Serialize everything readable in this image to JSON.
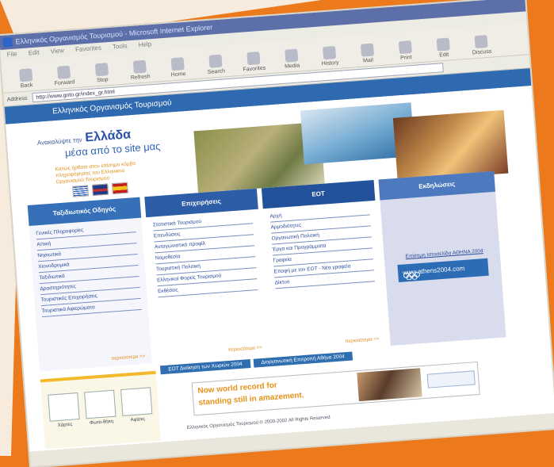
{
  "window": {
    "title": "Ελληνικός Οργανισμός Τουρισμού - Microsoft Internet Explorer"
  },
  "menu": [
    "File",
    "Edit",
    "View",
    "Favorites",
    "Tools",
    "Help"
  ],
  "toolbar": [
    {
      "label": "Back",
      "icon": "back-icon"
    },
    {
      "label": "Forward",
      "icon": "forward-icon"
    },
    {
      "label": "Stop",
      "icon": "stop-icon"
    },
    {
      "label": "Refresh",
      "icon": "refresh-icon"
    },
    {
      "label": "Home",
      "icon": "home-icon"
    },
    {
      "label": "Search",
      "icon": "search-icon"
    },
    {
      "label": "Favorites",
      "icon": "favorites-icon"
    },
    {
      "label": "Media",
      "icon": "media-icon"
    },
    {
      "label": "History",
      "icon": "history-icon"
    },
    {
      "label": "Mail",
      "icon": "mail-icon"
    },
    {
      "label": "Print",
      "icon": "print-icon"
    },
    {
      "label": "Edit",
      "icon": "edit-icon"
    },
    {
      "label": "Discuss",
      "icon": "discuss-icon"
    }
  ],
  "address": {
    "label": "Address",
    "value": "http://www.gnto.gr/index_gr.html"
  },
  "site": {
    "header": "Ελληνικός Οργανισμός Τουρισμού",
    "hero_line1": "Ανακαλύψτε την",
    "hero_line1_bold": "Ελλάδα",
    "hero_line2": "μέσα από το site μας",
    "hero_line3": "Καλώς ήρθατε στον επίσημο κόμβο πληροφόρησης του Ελληνικού Οργανισμού Τουρισμού"
  },
  "columns": [
    {
      "title": "Ταξιδιωτικός Οδηγός",
      "items": [
        "Γενικές Πληροφορίες",
        "Αττική",
        "Νησιωτικά",
        "Χιονοδρομικά",
        "Ταξιδιωτικά",
        "Δραστηριότητες",
        "Τουριστικές Επιχειρήσεις",
        "Τουριστικά Αφιερώματα"
      ],
      "more": "περισσότερα >>"
    },
    {
      "title": "Επιχειρήσεις",
      "items": [
        "Στατιστικά Τουρισμού",
        "Επενδύσεις",
        "Ανταγωνιστικό προφίλ",
        "Νομοθεσία",
        "Τουριστική Πολιτική",
        "Ελληνικοί Φορείς Τουρισμού",
        "Εκθέσεις"
      ],
      "more": "περισσότερα >>"
    },
    {
      "title": "ΕΟΤ",
      "items": [
        "Αρχή",
        "Αρμοδιότητες",
        "Οργανωτική Πολιτική",
        "Έργα και Προγράμματα",
        "Γραφεία",
        "Επαφή με τον ΕΟΤ - Νέα γραφεία",
        "Δίκτυο"
      ],
      "more": "περισσότερα >>"
    },
    {
      "title": "Εκδηλώσεις",
      "link": "Επίσημη Ιστοσελίδα ΑΘΗΝΑ 2004",
      "athens_url": "www.athens2004.com"
    }
  ],
  "bottom_tabs": [
    "ΕΟΤ Διοίκηση των Χωριών 2004",
    "Διοργανωτική Επιτροπή Αθήνα 2004"
  ],
  "footer": {
    "items": [
      {
        "label": "Χάρτες"
      },
      {
        "label": "Φωτο-θήκη"
      },
      {
        "label": "Αφίσες"
      }
    ],
    "ad_line1_a": "Now world record",
    "ad_line1_b": "for",
    "ad_line2_a": "standing still",
    "ad_line2_b": "in amazement.",
    "copyright": "Ελληνικός Οργανισμός Τουρισμού © 2000-2002 All Rights Reserved"
  }
}
